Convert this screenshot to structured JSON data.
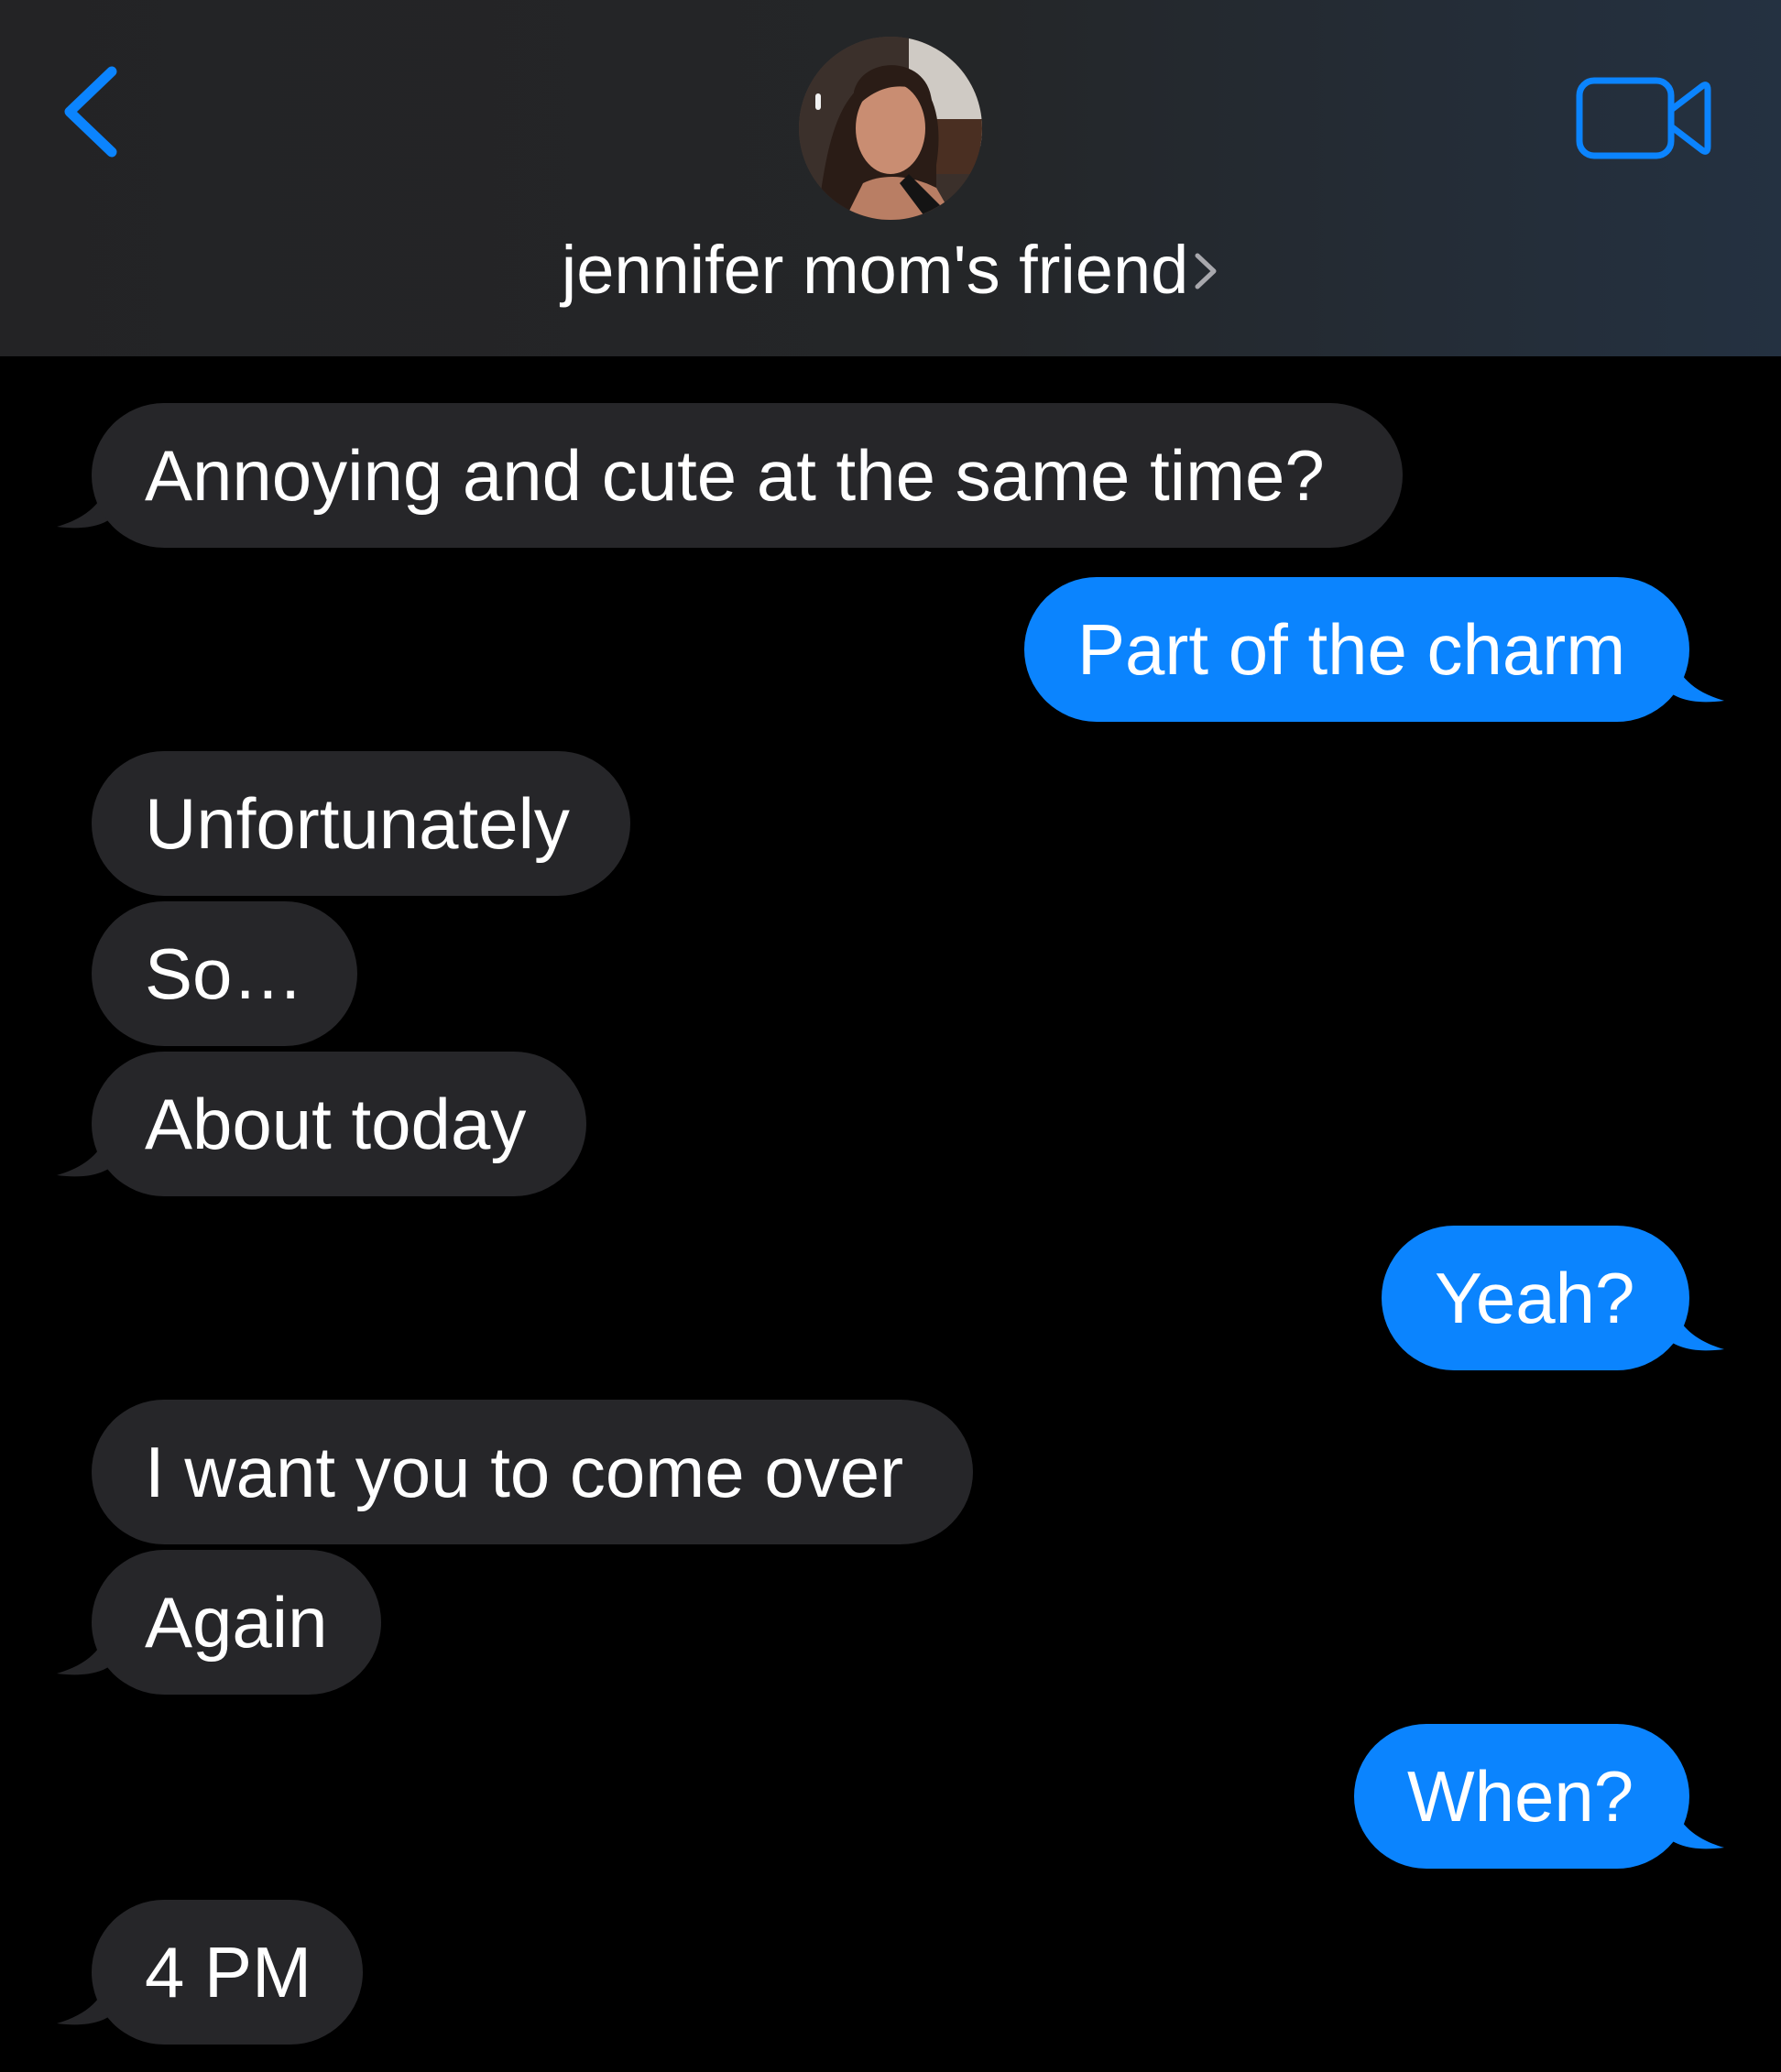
{
  "header": {
    "contact_name": "jennifer mom's friend",
    "back_icon": "chevron-left-icon",
    "video_icon": "video-camera-icon",
    "accent_color": "#0b84fe"
  },
  "messages": [
    {
      "direction": "incoming",
      "text": "Annoying and cute at the same time?"
    },
    {
      "direction": "outgoing",
      "text": "Part of the charm"
    },
    {
      "direction": "incoming",
      "text": "Unfortunately"
    },
    {
      "direction": "incoming",
      "text": "So…"
    },
    {
      "direction": "incoming",
      "text": "About today"
    },
    {
      "direction": "outgoing",
      "text": "Yeah?"
    },
    {
      "direction": "incoming",
      "text": "I want you to come over"
    },
    {
      "direction": "incoming",
      "text": "Again"
    },
    {
      "direction": "outgoing",
      "text": "When?"
    },
    {
      "direction": "incoming",
      "text": "4 PM"
    }
  ],
  "colors": {
    "incoming_bubble": "#262629",
    "outgoing_bubble": "#0b84fe",
    "background": "#000000"
  }
}
